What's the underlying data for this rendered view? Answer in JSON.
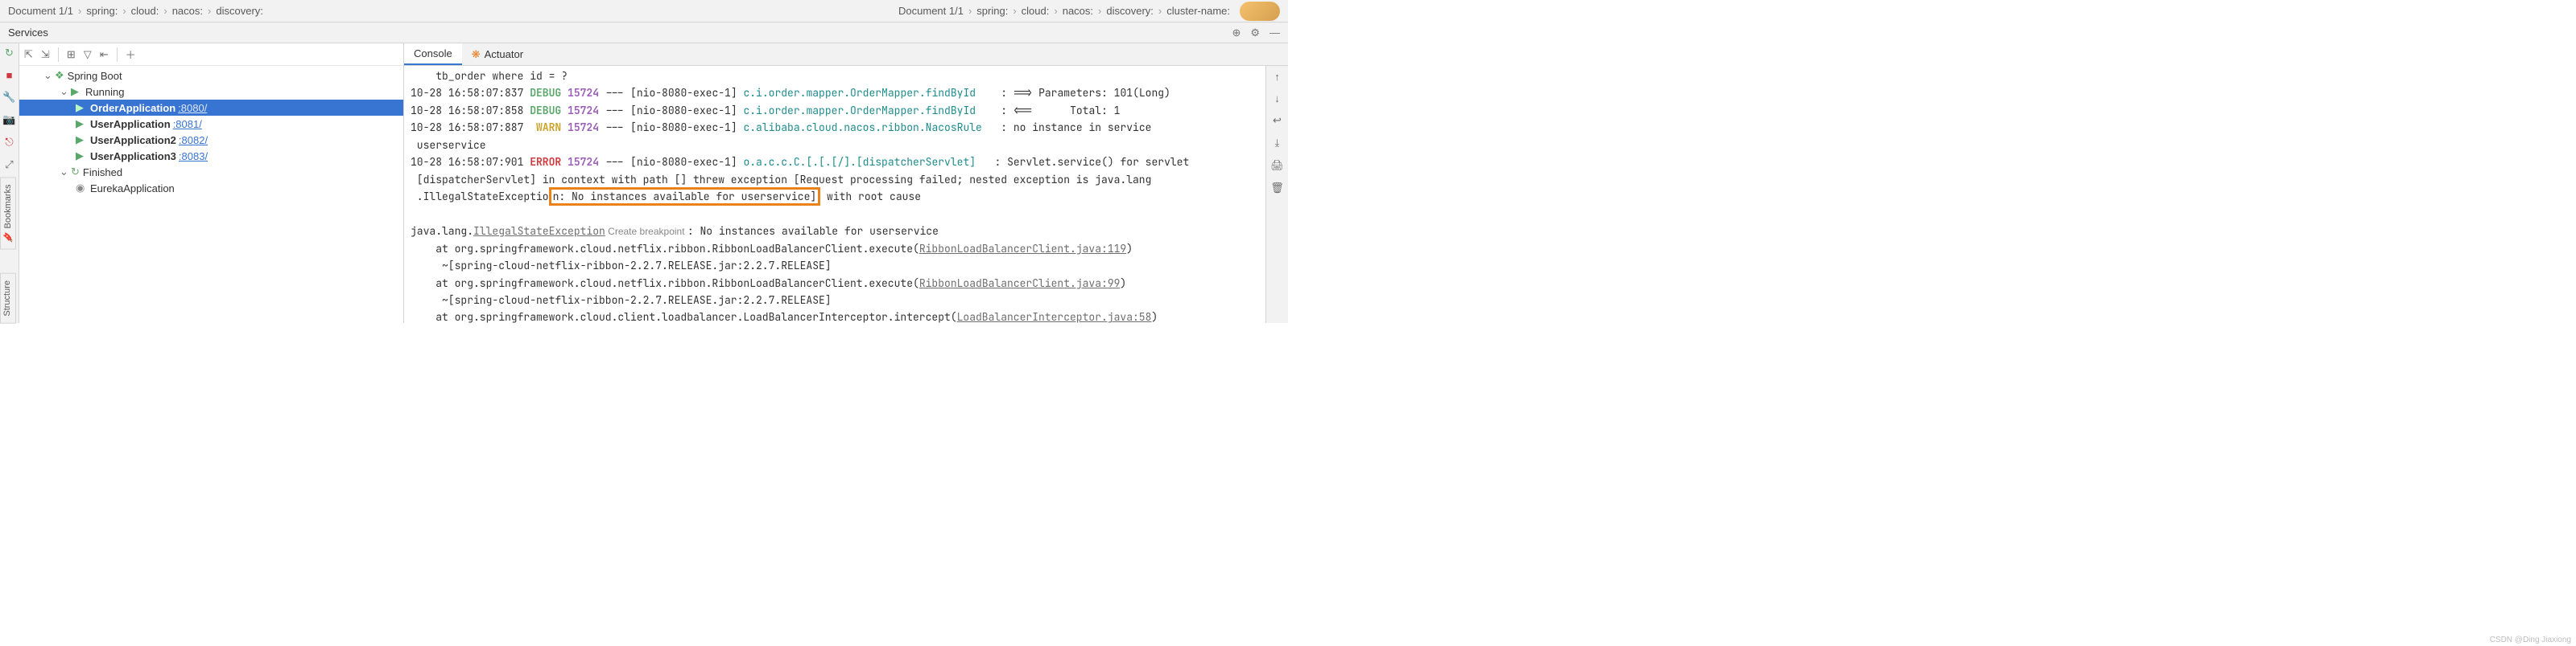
{
  "breadcrumb_left": [
    "Document 1/1",
    "spring:",
    "cloud:",
    "nacos:",
    "discovery:"
  ],
  "breadcrumb_right": [
    "Document 1/1",
    "spring:",
    "cloud:",
    "nacos:",
    "discovery:",
    "cluster-name:"
  ],
  "services_title": "Services",
  "side_tabs": {
    "bookmarks": "Bookmarks",
    "structure": "Structure"
  },
  "tree": {
    "root": "Spring Boot",
    "running": "Running",
    "finished": "Finished",
    "apps": [
      {
        "name": "OrderApplication",
        "port": ":8080/"
      },
      {
        "name": "UserApplication",
        "port": ":8081/"
      },
      {
        "name": "UserApplication2",
        "port": ":8082/"
      },
      {
        "name": "UserApplication3",
        "port": ":8083/"
      }
    ],
    "finished_apps": [
      "EurekaApplication"
    ]
  },
  "tabs": {
    "console": "Console",
    "actuator": "Actuator"
  },
  "log": {
    "l0": "    tb_order where id = ?",
    "l1_a": "10-28 16:58:07:837 ",
    "l1_b": "DEBUG",
    "l1_c": " ",
    "l1_d": "15724",
    "l1_e": " --- [nio-8080-exec-1] ",
    "l1_f": "c.i.order.mapper.OrderMapper.findById",
    "l1_g": "    : ==> Parameters: 101(Long)",
    "l2_a": "10-28 16:58:07:858 ",
    "l2_b": "DEBUG",
    "l2_c": " ",
    "l2_d": "15724",
    "l2_e": " --- [nio-8080-exec-1] ",
    "l2_f": "c.i.order.mapper.OrderMapper.findById",
    "l2_g": "    : <==      Total: 1",
    "l3_a": "10-28 16:58:07:887  ",
    "l3_b": "WARN",
    "l3_c": " ",
    "l3_d": "15724",
    "l3_e": " --- [nio-8080-exec-1] ",
    "l3_f": "c.alibaba.cloud.nacos.ribbon.NacosRule",
    "l3_g": "   : no instance in service",
    "l4": " userservice",
    "l5_a": "10-28 16:58:07:901 ",
    "l5_b": "ERROR",
    "l5_c": " ",
    "l5_d": "15724",
    "l5_e": " --- [nio-8080-exec-1] ",
    "l5_f": "o.a.c.c.C.[.[.[/].[dispatcherServlet]",
    "l5_g": "   : Servlet.service() for servlet",
    "l6": " [dispatcherServlet] in context with path [] threw exception [Request processing failed; nested exception is java.lang",
    "l7_a": " .IllegalStateExceptio",
    "l7_b": "n: No instances available for userservice]",
    "l7_c": " with root cause",
    "l8": " ",
    "l9_a": "java.lang.",
    "l9_b": "IllegalStateException",
    "l9_c": " Create breakpoint ",
    "l9_d": ": No instances available for userservice",
    "l10_a": "    at org.springframework.cloud.netflix.ribbon.RibbonLoadBalancerClient.execute(",
    "l10_b": "RibbonLoadBalancerClient.java:119",
    "l10_c": ")",
    "l11": "     ~[spring-cloud-netflix-ribbon-2.2.7.RELEASE.jar:2.2.7.RELEASE]",
    "l12_a": "    at org.springframework.cloud.netflix.ribbon.RibbonLoadBalancerClient.execute(",
    "l12_b": "RibbonLoadBalancerClient.java:99",
    "l12_c": ")",
    "l13": "     ~[spring-cloud-netflix-ribbon-2.2.7.RELEASE.jar:2.2.7.RELEASE]",
    "l14_a": "    at org.springframework.cloud.client.loadbalancer.LoadBalancerInterceptor.intercept(",
    "l14_b": "LoadBalancerInterceptor.java:58",
    "l14_c": ")"
  },
  "watermark": "CSDN @Ding Jiaxiong"
}
